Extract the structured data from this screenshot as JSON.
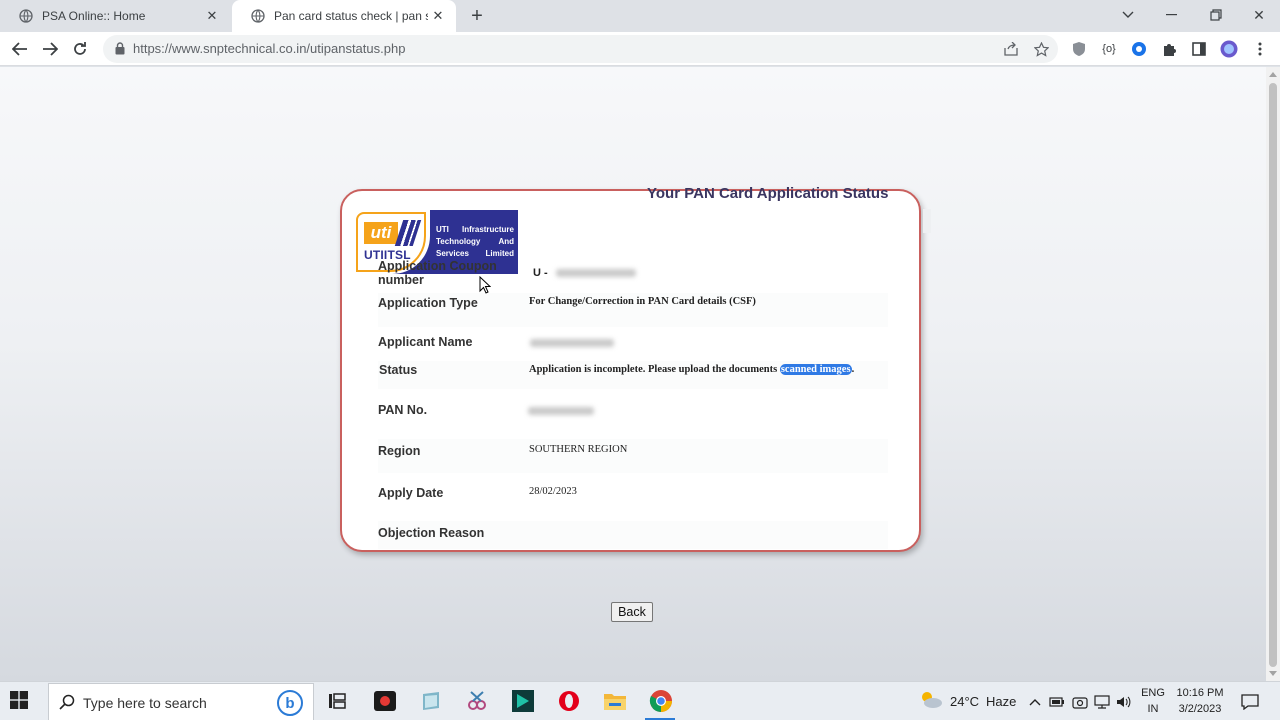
{
  "browser": {
    "tabs": [
      {
        "title": "PSA Online:: Home",
        "active": false
      },
      {
        "title": "Pan card status check | pan statu",
        "active": true
      }
    ],
    "url": "https://www.snptechnical.co.in/utipanstatus.php"
  },
  "page": {
    "heading": "Your PAN Card Application Status",
    "logo": {
      "mark": "uti",
      "name": "UTIITSL",
      "description": "UTI Infrastructure Technology And Services Limited"
    },
    "rows": [
      {
        "label": "Application Coupon number",
        "value_prefix": "U -",
        "value": ""
      },
      {
        "label": "Application Type",
        "value": "For Change/Correction in PAN Card details (CSF)"
      },
      {
        "label": "Applicant Name",
        "value": ""
      },
      {
        "label": "Status",
        "value": "Application is incomplete. Please upload the documents ",
        "highlight": "scanned images",
        "suffix": "."
      },
      {
        "label": "PAN No.",
        "value": ""
      },
      {
        "label": "Region",
        "value": "SOUTHERN REGION"
      },
      {
        "label": "Apply Date",
        "value": "28/02/2023"
      },
      {
        "label": "Objection Reason",
        "value": ""
      }
    ],
    "back_label": "Back"
  },
  "taskbar": {
    "search_placeholder": "Type here to search",
    "weather_temp": "24°C",
    "weather_desc": "Haze",
    "lang_top": "ENG",
    "lang_bottom": "IN",
    "time": "10:16 PM",
    "date": "3/2/2023"
  },
  "colors": {
    "card_border": "#c9605e",
    "logo_blue": "#2e3192",
    "logo_orange": "#f5a31a",
    "highlight": "#2f7ae5"
  }
}
